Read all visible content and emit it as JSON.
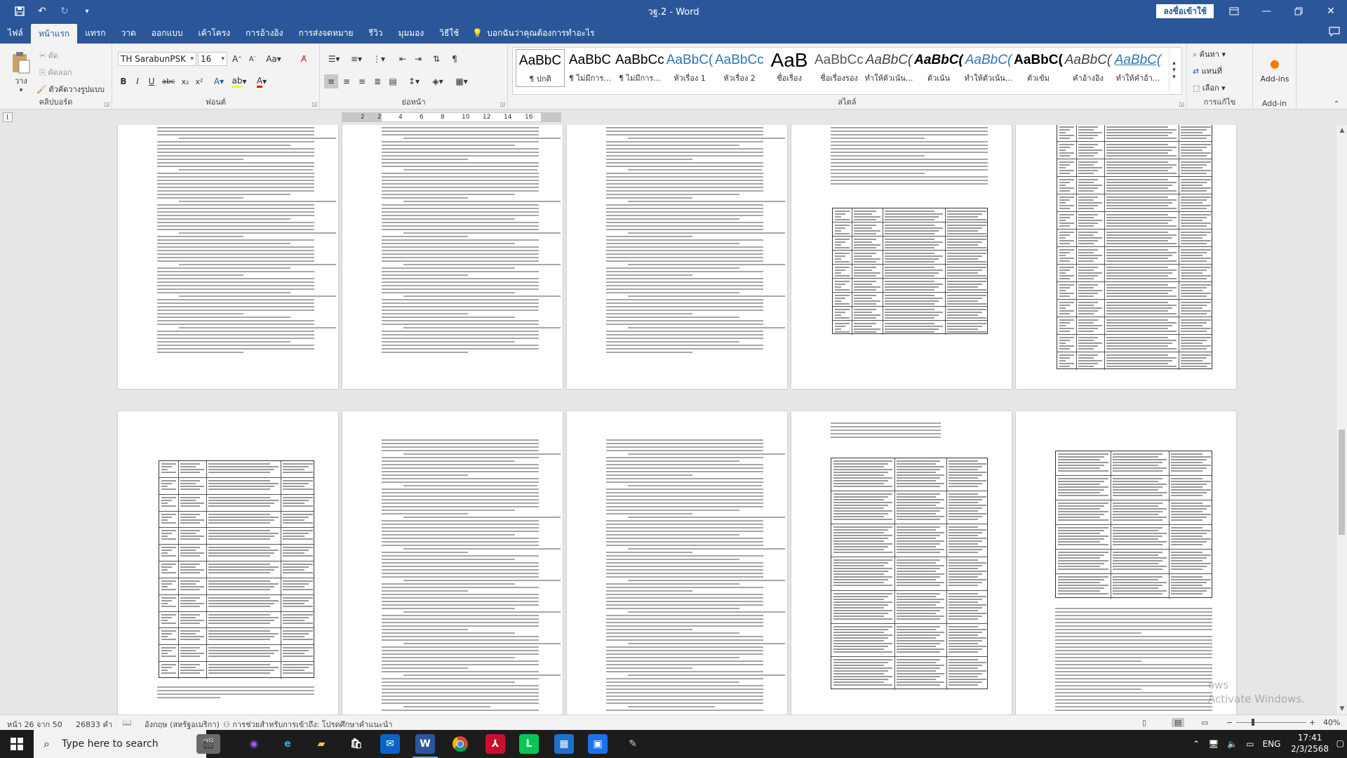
{
  "window": {
    "title": "วฐ.2 - Word",
    "signin_label": "ลงชื่อเข้าใช้",
    "qat": [
      "save-icon",
      "undo-icon",
      "redo-icon",
      "customize-icon"
    ]
  },
  "tabs": [
    "ไฟล์",
    "หน้าแรก",
    "แทรก",
    "วาด",
    "ออกแบบ",
    "เค้าโครง",
    "การอ้างอิง",
    "การส่งจดหมาย",
    "รีวิว",
    "มุมมอง",
    "วิธีใช้"
  ],
  "active_tab": "หน้าแรก",
  "tellme": "บอกฉันว่าคุณต้องการทำอะไร",
  "ribbon": {
    "clipboard": {
      "paste": "วาง",
      "cut": "ตัด",
      "copy": "คัดลอก",
      "format_painter": "ตัวคัดวางรูปแบบ",
      "label": "คลิปบอร์ด"
    },
    "font": {
      "name": "TH SarabunPSK",
      "size": "16",
      "label": "ฟอนต์",
      "buttons": [
        "B",
        "I",
        "U",
        "abc",
        "x₂",
        "x²"
      ]
    },
    "paragraph": {
      "label": "ย่อหน้า"
    },
    "styles": {
      "label": "สไตล์",
      "items": [
        {
          "sample": "AaBbC",
          "name": "¶ ปกติ"
        },
        {
          "sample": "AaBbC",
          "name": "¶ ไม่มีการ..."
        },
        {
          "sample": "AaBbCcDc",
          "name": "¶ ไม่มีการ..."
        },
        {
          "sample": "AaBbC(",
          "name": "หัวเรื่อง 1"
        },
        {
          "sample": "AaBbCcE",
          "name": "หัวเรื่อง 2"
        },
        {
          "sample": "AaB",
          "name": "ชื่อเรื่อง"
        },
        {
          "sample": "AaBbCcD",
          "name": "ชื่อเรื่องรอง"
        },
        {
          "sample": "AaBbC(",
          "name": "ทำให้ตัวเน้น..."
        },
        {
          "sample": "AaBbC(",
          "name": "ตัวเน้น"
        },
        {
          "sample": "AaBbC(",
          "name": "ทำให้ตัวเน้น..."
        },
        {
          "sample": "AaBbC(",
          "name": "ตัวเข้ม"
        },
        {
          "sample": "AaBbC(",
          "name": "คำอ้างอิง"
        },
        {
          "sample": "AaBbC(",
          "name": "ทำให้คำอ้า..."
        }
      ]
    },
    "editing": {
      "label": "การแก้ไข",
      "find": "ค้นหา",
      "replace": "แทนที่",
      "select": "เลือก"
    },
    "addins": {
      "button": "Add-ins",
      "label": "Add-in"
    }
  },
  "ruler": {
    "ticks": [
      "2",
      "2",
      "4",
      "6",
      "8",
      "10",
      "12",
      "14",
      "16"
    ]
  },
  "status": {
    "page": "หน้า 26 จาก 50",
    "words": "26833 คำ",
    "language": "อังกฤษ (สหรัฐอเมริกา)",
    "accessibility": "การช่วยสำหรับการเข้าถึง: โปรดศึกษาคำแนะนำ",
    "zoom": "40%"
  },
  "taskbar": {
    "search_placeholder": "Type here to search",
    "apps": [
      "task-view",
      "figma",
      "edge",
      "file-explorer",
      "store",
      "mail",
      "word",
      "chrome",
      "acrobat",
      "line",
      "calculator",
      "calendar",
      "other"
    ],
    "language": "ENG",
    "time": "17:41",
    "date": "2/3/2568"
  },
  "watermark": {
    "line1": "ows",
    "line2": "Activate Windows."
  },
  "colors": {
    "accent": "#2b579a",
    "taskbar": "#1c1c1c",
    "word_icon": "#2b579a"
  }
}
